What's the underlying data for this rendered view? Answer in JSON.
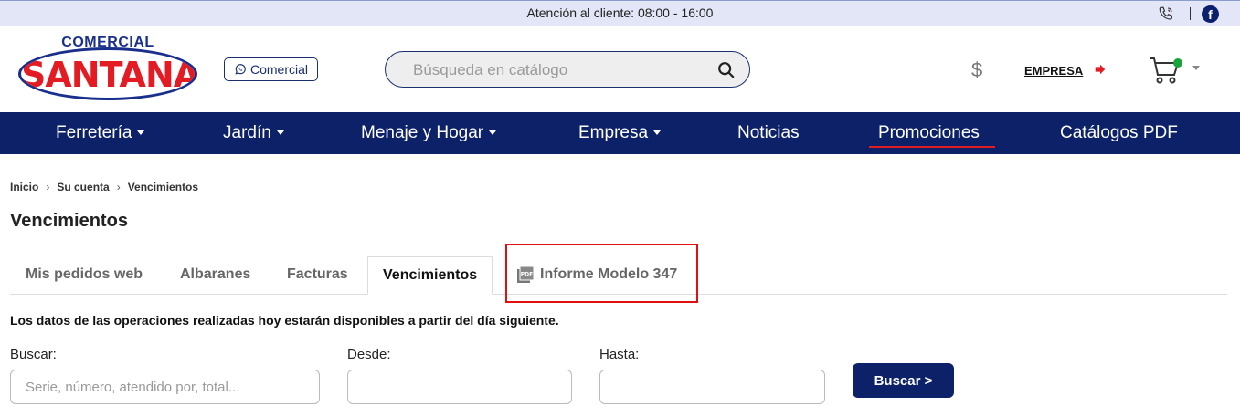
{
  "topbar": {
    "message": "Atención al cliente: 08:00 - 16:00",
    "icons": [
      "phone-icon",
      "facebook-icon"
    ],
    "facebook_glyph": "f"
  },
  "logo": {
    "line1": "COMERCIAL",
    "line2": "SANTANA"
  },
  "header": {
    "whatsapp_label": "Comercial",
    "search_placeholder": "Búsqueda en catálogo",
    "currency_symbol": "$",
    "account_label": "EMPRESA"
  },
  "nav": {
    "items": [
      {
        "label": "Ferretería",
        "dropdown": true
      },
      {
        "label": "Jardín",
        "dropdown": true
      },
      {
        "label": "Menaje y Hogar",
        "dropdown": true
      },
      {
        "label": "Empresa",
        "dropdown": true
      },
      {
        "label": "Noticias",
        "dropdown": false
      },
      {
        "label": "Promociones",
        "dropdown": false,
        "active": true
      },
      {
        "label": "Catálogos PDF",
        "dropdown": false
      }
    ]
  },
  "breadcrumb": {
    "items": [
      "Inicio",
      "Su cuenta",
      "Vencimientos"
    ],
    "separator": "›"
  },
  "page": {
    "title": "Vencimientos",
    "notice": "Los datos de las operaciones realizadas hoy estarán disponibles a partir del día siguiente."
  },
  "tabs": {
    "items": [
      {
        "label": "Mis pedidos web",
        "active": false
      },
      {
        "label": "Albaranes",
        "active": false
      },
      {
        "label": "Facturas",
        "active": false
      },
      {
        "label": "Vencimientos",
        "active": true
      },
      {
        "label": "Informe Modelo 347",
        "active": false,
        "icon": "pdf-icon",
        "highlighted": true
      }
    ]
  },
  "filters": {
    "search_label": "Buscar:",
    "search_placeholder": "Serie, número, atendido por, total...",
    "search_value": "",
    "from_label": "Desde:",
    "from_value": "",
    "to_label": "Hasta:",
    "to_value": "",
    "submit_label": "Buscar >"
  },
  "colors": {
    "brand_navy": "#0c2168",
    "brand_red": "#e31b23",
    "topbar_bg": "#e3e6f6",
    "highlight_red": "#e01010",
    "cart_dot_green": "#1aa33a"
  }
}
